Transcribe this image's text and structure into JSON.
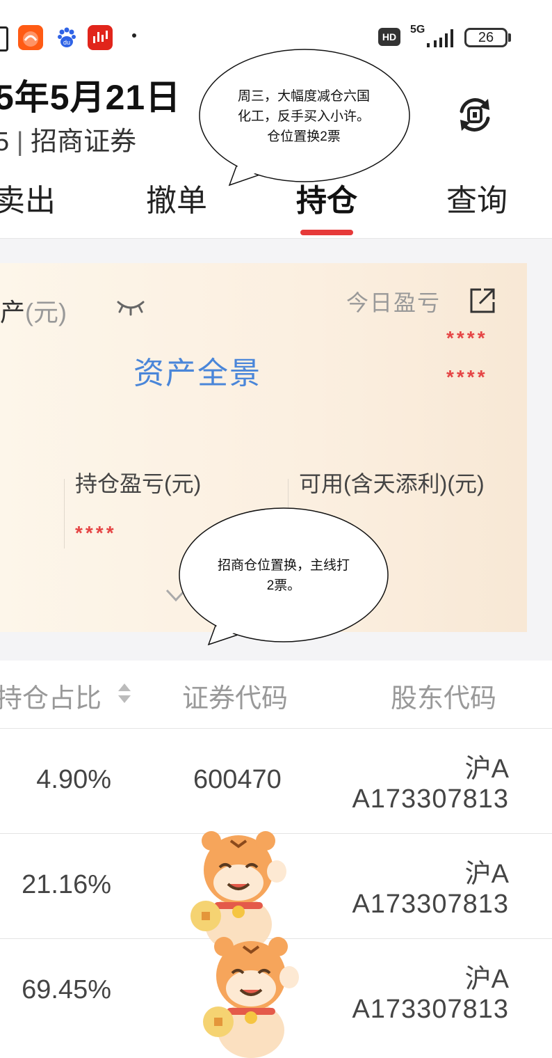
{
  "status_bar": {
    "network": "5G",
    "hd_badge": "HD",
    "battery": "26",
    "app_icons": [
      "box-icon",
      "taobao-icon",
      "baidu-icon",
      "stock-app-icon"
    ]
  },
  "header": {
    "date_title": "5年5月21日",
    "broker_prefix": "5",
    "broker_name": "招商证券",
    "refresh_icon": "refresh-cycle-icon"
  },
  "tabs": [
    {
      "label": "卖出",
      "active": false
    },
    {
      "label": "撤单",
      "active": false
    },
    {
      "label": "持仓",
      "active": true
    },
    {
      "label": "查询",
      "active": false
    }
  ],
  "asset_card": {
    "total_label": "产",
    "total_unit": "(元)",
    "today_pl_label": "今日盈亏",
    "today_pl_value": "****",
    "today_pl_rate": "****",
    "overview_link": "资产全景",
    "holding_pl_label": "持仓盈亏(元)",
    "holding_pl_value": "****",
    "available_label": "可用(含天添利)(元)"
  },
  "table": {
    "headers": {
      "ratio": "持仓占比",
      "code": "证券代码",
      "holder": "股东代码"
    },
    "rows": [
      {
        "ratio": "4.90%",
        "code": "600470",
        "market": "沪A",
        "account": "A173307813"
      },
      {
        "ratio": "21.16%",
        "code": "",
        "market": "沪A",
        "account": "A173307813"
      },
      {
        "ratio": "69.45%",
        "code": "",
        "market": "沪A",
        "account": "A173307813"
      }
    ]
  },
  "annotations": {
    "bubble1": [
      "周三，大幅度减仓六国",
      "化工，反手买入小许。",
      "仓位置换2票"
    ],
    "bubble2": [
      "招商仓位置换，主线打",
      "2票。"
    ]
  },
  "colors": {
    "accent_red": "#e63a3a",
    "mask_red": "#e54545",
    "link_blue": "#4a86d9",
    "card_bg": "#fbefe0"
  }
}
